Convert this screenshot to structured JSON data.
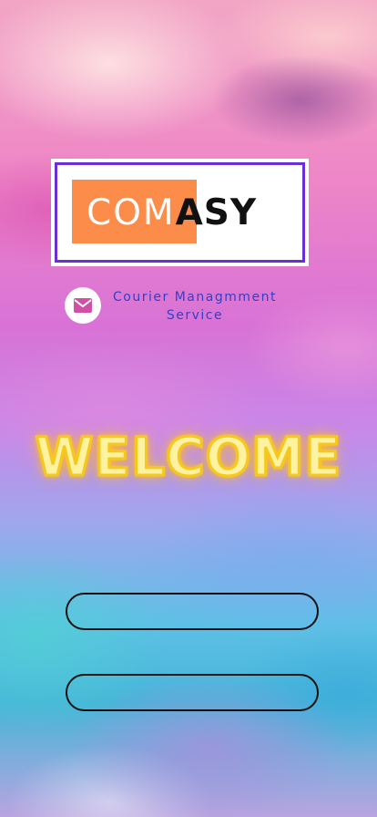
{
  "app": {
    "logo": {
      "part_light": "COM",
      "part_dark": "ASY",
      "orange": "#fb8c4a",
      "frame": "#6a2fd6"
    },
    "tagline": {
      "line1": "Courier Managmment",
      "line2": "Service",
      "icon": "mail-icon"
    },
    "welcome": "WELCOME",
    "buttons": [
      {
        "label": ""
      },
      {
        "label": ""
      }
    ]
  }
}
